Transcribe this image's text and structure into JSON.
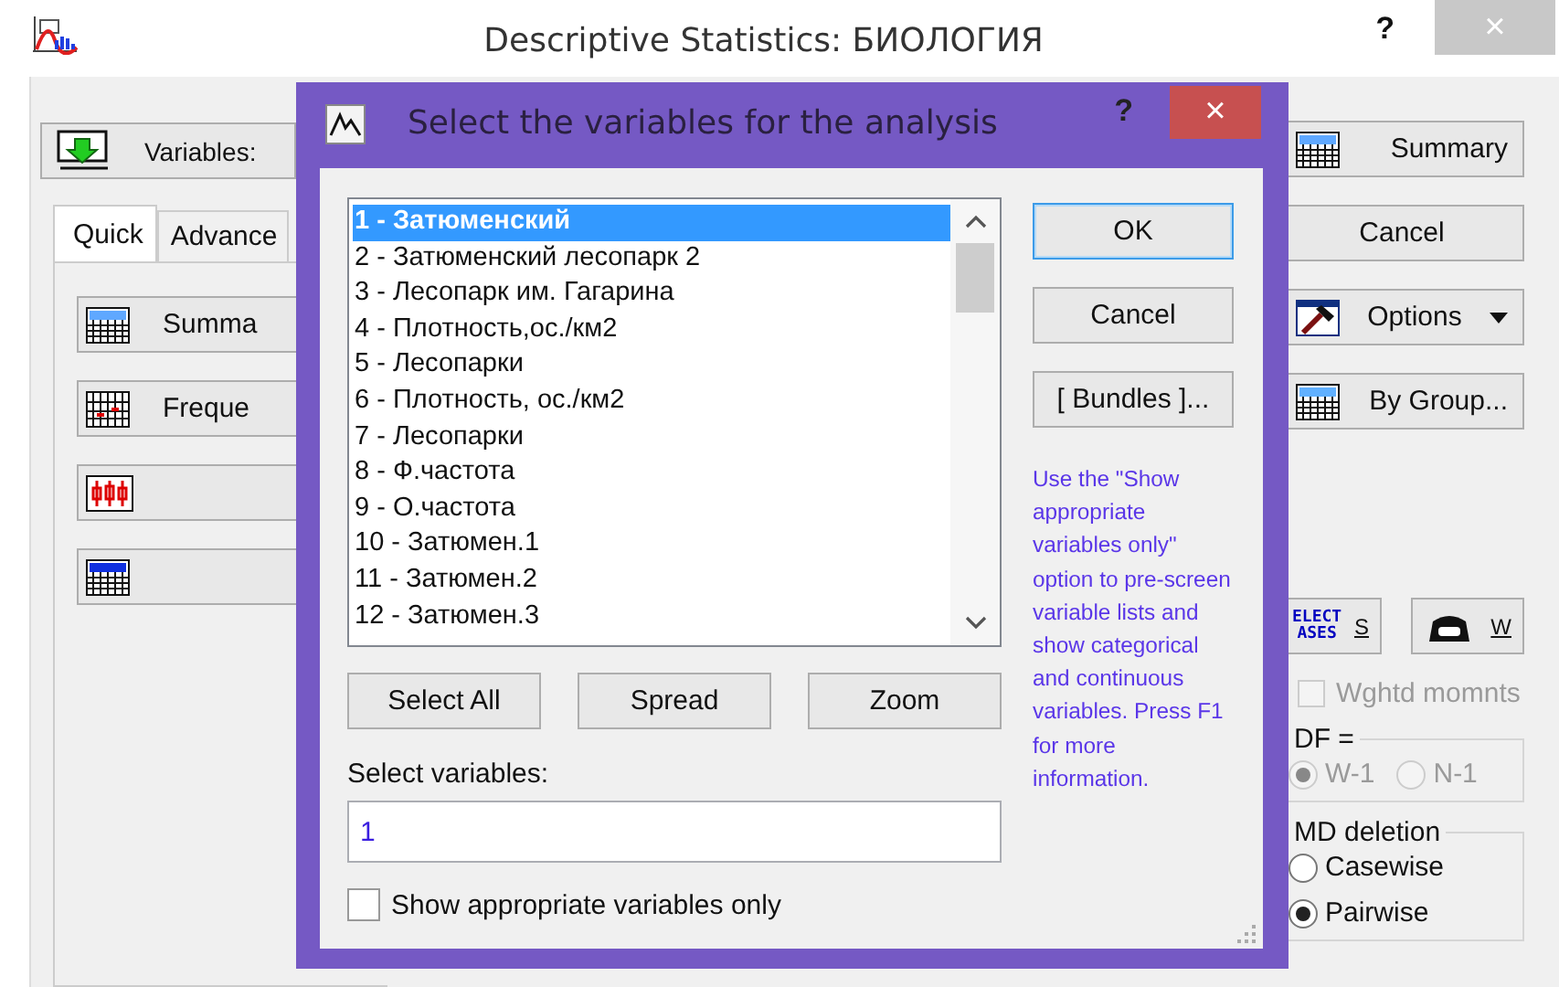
{
  "window": {
    "title": "Descriptive Statistics: БИОЛОГИЯ",
    "help": "?",
    "close": "×"
  },
  "variables_button": {
    "label": "Variables:"
  },
  "tabs": [
    {
      "label": "Quick",
      "selected": true
    },
    {
      "label": "Advance",
      "selected": false
    }
  ],
  "quick_buttons": [
    {
      "kind": "summary",
      "label": "Summa"
    },
    {
      "kind": "frequency",
      "label": "Freque"
    },
    {
      "kind": "boxplot"
    },
    {
      "kind": "table"
    }
  ],
  "side_buttons": [
    {
      "kind": "summary",
      "label": "Summary"
    },
    {
      "kind": "plain",
      "label": "Cancel"
    },
    {
      "kind": "options",
      "label": "Options"
    },
    {
      "kind": "bygroup",
      "label": "By Group..."
    }
  ],
  "case_buttons": [
    {
      "kind": "select_cases",
      "icon_text": [
        "ELECT",
        "ASES"
      ],
      "label": "S"
    },
    {
      "kind": "weights",
      "label": "W"
    }
  ],
  "weighted_moments": {
    "label": "Wghtd momnts",
    "checked": false,
    "disabled": true
  },
  "df": {
    "legend": "DF =",
    "disabled": true,
    "options": [
      {
        "label": "W-1",
        "selected": true
      },
      {
        "label": "N-1",
        "selected": false
      }
    ]
  },
  "md_deletion": {
    "legend": "MD deletion",
    "options": [
      {
        "label": "Casewise",
        "selected": false
      },
      {
        "label": "Pairwise",
        "selected": true
      }
    ]
  },
  "dialog": {
    "title": "Select the variables for the analysis",
    "help": "?",
    "close": "×",
    "variables": [
      {
        "label": "1 - Затюменский",
        "selected": true
      },
      {
        "label": "2 - Затюменский лесопарк 2",
        "selected": false
      },
      {
        "label": "3 - Лесопарк им. Гагарина",
        "selected": false
      },
      {
        "label": "4 - Плотность,ос./км2",
        "selected": false
      },
      {
        "label": "5 - Лесопарки",
        "selected": false
      },
      {
        "label": "6 - Плотность, ос./км2",
        "selected": false
      },
      {
        "label": "7 - Лесопарки",
        "selected": false
      },
      {
        "label": "8 - Ф.частота",
        "selected": false
      },
      {
        "label": "9 - О.частота",
        "selected": false
      },
      {
        "label": "10 - Затюмен.1",
        "selected": false
      },
      {
        "label": "11 - Затюмен.2",
        "selected": false
      },
      {
        "label": "12 - Затюмен.3",
        "selected": false
      }
    ],
    "list_buttons": [
      "Select All",
      "Spread",
      "Zoom"
    ],
    "buttons": [
      {
        "label": "OK",
        "focused": true
      },
      {
        "label": "Cancel",
        "focused": false
      },
      {
        "label": "[ Bundles ]...",
        "focused": false
      }
    ],
    "hint": "Use the \"Show appropriate variables only\" option to pre-screen variable lists and show categorical and continuous variables. Press F1 for more information.",
    "select_label": "Select variables:",
    "select_value": "1",
    "show_appropriate": {
      "label": "Show appropriate variables only",
      "checked": false
    }
  }
}
